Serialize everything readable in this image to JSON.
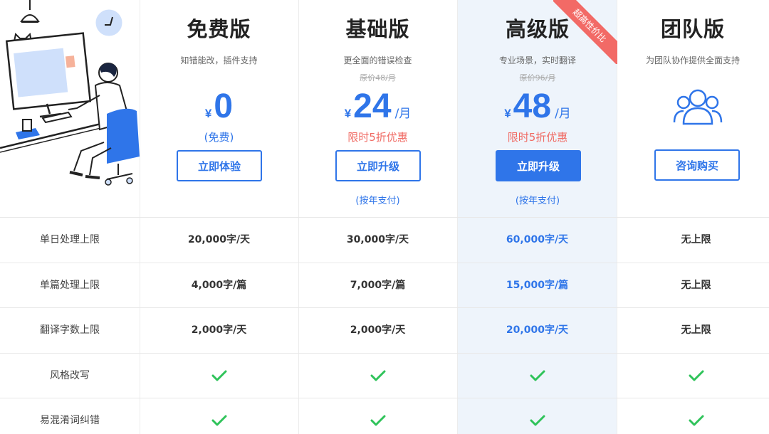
{
  "colors": {
    "accent": "#2f75e9",
    "highlight_bg": "#eef4fb",
    "promo": "#f06a63",
    "check": "#2fc35a",
    "ribbon": "#f26a66"
  },
  "illustration": {
    "icon": "person-at-computer-illustration"
  },
  "plans": [
    {
      "name": "免费版",
      "desc": "知错能改，插件支持",
      "original_price": "",
      "currency": "¥",
      "amount": "0",
      "unit": "",
      "sub": "(免费)",
      "button": "立即体验",
      "note": ""
    },
    {
      "name": "基础版",
      "desc": "更全面的错误检查",
      "original_price": "原价48/月",
      "currency": "¥",
      "amount": "24",
      "unit": "/月",
      "sub": "限时5折优惠",
      "button": "立即升级",
      "note": "(按年支付)"
    },
    {
      "name": "高级版",
      "desc": "专业场景，实时翻译",
      "original_price": "原价96/月",
      "currency": "¥",
      "amount": "48",
      "unit": "/月",
      "sub": "限时5折优惠",
      "button": "立即升级",
      "note": "(按年支付)",
      "ribbon": "超高性价比"
    },
    {
      "name": "团队版",
      "desc": "为团队协作提供全面支持",
      "icon": "team-users-icon",
      "button": "咨询购买"
    }
  ],
  "features": [
    {
      "label": "单日处理上限",
      "values": [
        "20,000字/天",
        "30,000字/天",
        "60,000字/天",
        "无上限"
      ]
    },
    {
      "label": "单篇处理上限",
      "values": [
        "4,000字/篇",
        "7,000字/篇",
        "15,000字/篇",
        "无上限"
      ]
    },
    {
      "label": "翻译字数上限",
      "values": [
        "2,000字/天",
        "2,000字/天",
        "20,000字/天",
        "无上限"
      ]
    },
    {
      "label": "风格改写",
      "values": [
        "check",
        "check",
        "check",
        "check"
      ]
    },
    {
      "label": "易混淆词纠错",
      "values": [
        "check",
        "check",
        "check",
        "check"
      ]
    }
  ]
}
